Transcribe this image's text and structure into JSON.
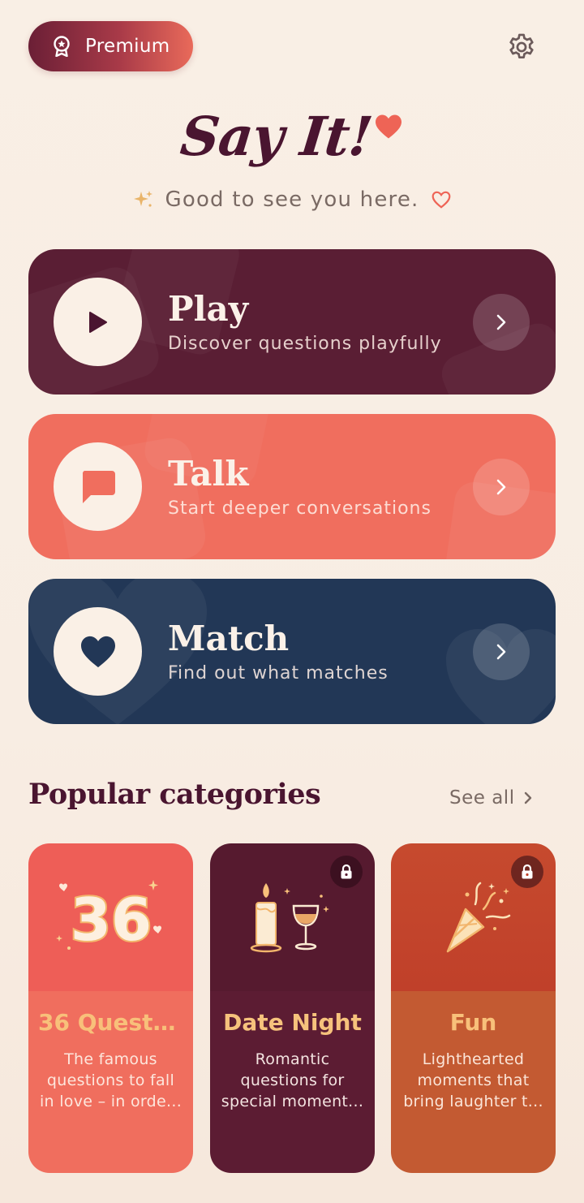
{
  "header": {
    "premium_label": "Premium",
    "settings_icon": "gear-icon"
  },
  "logo": {
    "text": "Say It!"
  },
  "greeting": {
    "text": "Good to see you here."
  },
  "modes": [
    {
      "title": "Play",
      "subtitle": "Discover questions playfully",
      "icon": "play-icon",
      "color": "#5a1e34"
    },
    {
      "title": "Talk",
      "subtitle": "Start deeper conversations",
      "icon": "chat-bubble-icon",
      "color": "#f06e5e"
    },
    {
      "title": "Match",
      "subtitle": "Find out what matches",
      "icon": "heart-icon",
      "color": "#223756"
    }
  ],
  "categories_section": {
    "title": "Popular categories",
    "see_all": "See all"
  },
  "categories": [
    {
      "title": "36 Questi...",
      "desc": [
        "The famous",
        "questions to fall",
        "in love – in orde..."
      ],
      "locked": false,
      "icon": "number-36-icon"
    },
    {
      "title": "Date Night",
      "desc": [
        "Romantic",
        "questions for",
        "special moment..."
      ],
      "locked": true,
      "icon": "candle-wine-icon"
    },
    {
      "title": "Fun",
      "desc": [
        "Lighthearted",
        "moments that",
        "bring laughter t..."
      ],
      "locked": true,
      "icon": "party-popper-icon"
    }
  ],
  "colors": {
    "background": "#f9efe5",
    "primary_dark": "#4a1530",
    "accent_coral": "#f06e5e",
    "navy": "#223756",
    "gold": "#f6c27c"
  }
}
